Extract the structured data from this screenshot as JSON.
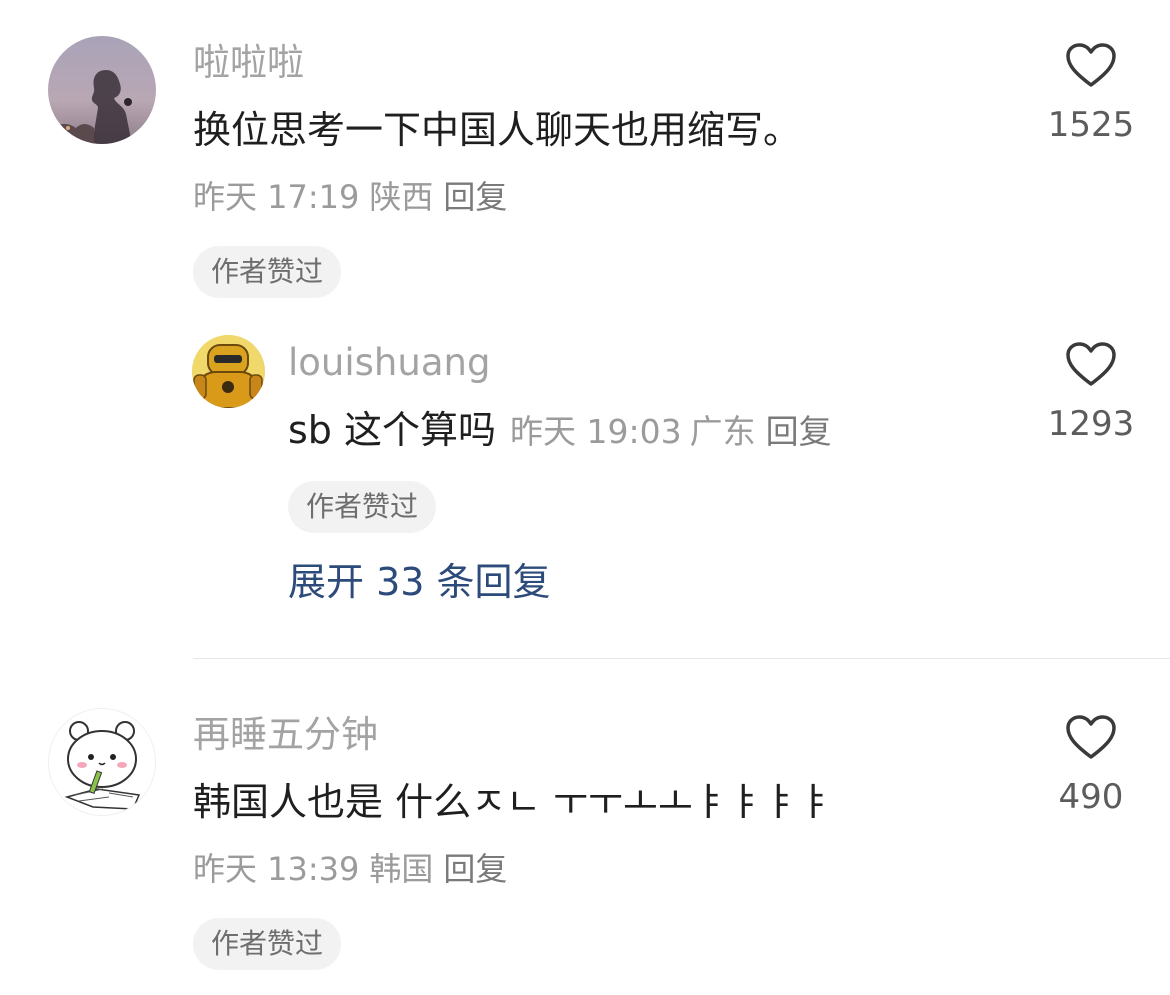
{
  "comments": [
    {
      "username": "啦啦啦",
      "text": "换位思考一下中国人聊天也用缩写。",
      "time": "昨天 17:19",
      "location": "陕西",
      "reply_label": "回复",
      "badge": "作者赞过",
      "likes": "1525",
      "avatar_icon": "silhouette-photo-avatar",
      "replies": [
        {
          "username": "louishuang",
          "text": "sb 这个算吗",
          "time": "昨天 19:03",
          "location": "广东",
          "reply_label": "回复",
          "badge": "作者赞过",
          "likes": "1293",
          "avatar_icon": "yellow-robot-avatar"
        }
      ],
      "expand_label": "展开 33 条回复"
    },
    {
      "username": "再睡五分钟",
      "text": "韩国人也是 什么ㅈㄴ ㅜㅜㅗㅗㅑㅑㅑㅑ",
      "time": "昨天 13:39",
      "location": "韩国",
      "reply_label": "回复",
      "badge": "作者赞过",
      "likes": "490",
      "avatar_icon": "cartoon-bear-avatar"
    }
  ],
  "colors": {
    "username": "#a3a3a3",
    "text": "#1f1f1f",
    "meta": "#9b9b9b",
    "expand_link": "#2c4a7a",
    "badge_bg": "#f2f2f2"
  }
}
